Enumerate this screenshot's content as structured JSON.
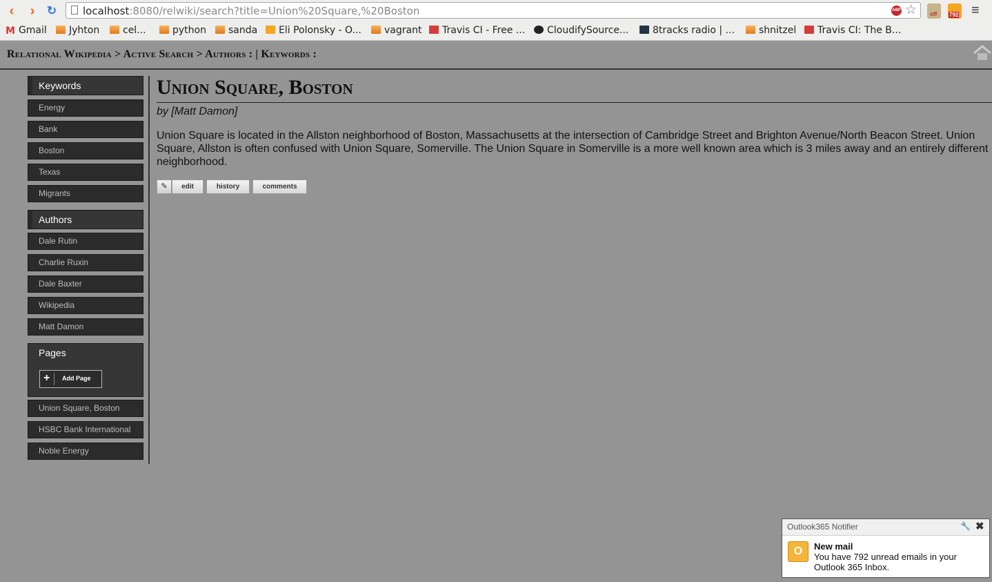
{
  "browser": {
    "url_host": "localhost",
    "url_rest": ":8080/relwiki/search?title=Union%20Square,%20Boston",
    "extension_badge": "792",
    "extension_badge_off": "off"
  },
  "bookmarks": [
    {
      "label": "Gmail",
      "icon": "gmail-icon"
    },
    {
      "label": "Jyhton",
      "icon": "folder-icon"
    },
    {
      "label": "cel...",
      "icon": "folder-icon"
    },
    {
      "label": "python",
      "icon": "folder-icon"
    },
    {
      "label": "sanda",
      "icon": "folder-icon"
    },
    {
      "label": "Eli Polonsky - O...",
      "icon": "office-icon"
    },
    {
      "label": "vagrant",
      "icon": "folder-icon"
    },
    {
      "label": "Travis CI - Free ...",
      "icon": "travis-icon"
    },
    {
      "label": "CloudifySource...",
      "icon": "github-icon"
    },
    {
      "label": "8tracks radio | ...",
      "icon": "8tracks-icon"
    },
    {
      "label": "shnitzel",
      "icon": "folder-icon"
    },
    {
      "label": "Travis CI: The B...",
      "icon": "travis-icon"
    }
  ],
  "breadcrumb": "Relational Wikipedia > Active Search > Authors : | Keywords :",
  "sidebar": {
    "keywords_title": "Keywords",
    "keywords": [
      "Energy",
      "Bank",
      "Boston",
      "Texas",
      "Migrants"
    ],
    "authors_title": "Authors",
    "authors": [
      "Dale Rutin",
      "Charlie Ruxin",
      "Dale Baxter",
      "Wikipedia",
      "Matt Damon"
    ],
    "pages_title": "Pages",
    "add_page_label": "Add Page",
    "pages": [
      "Union Square, Boston",
      "HSBC Bank International",
      "Noble Energy"
    ]
  },
  "article": {
    "title": "Union Square, Boston",
    "byline": "by [Matt Damon]",
    "body": "Union Square is located in the Allston neighborhood of Boston, Massachusetts at the intersection of Cambridge Street and Brighton Avenue/North Beacon Street. Union Square, Allston is often confused with Union Square, Somerville. The Union Square in Somerville is a more well known area which is 3 miles away and an entirely different neighborhood.",
    "edit_label": "edit",
    "history_label": "history",
    "comments_label": "comments"
  },
  "notifier": {
    "title": "Outlook365 Notifier",
    "heading": "New mail",
    "body": "You have 792 unread emails in your Outlook 365 Inbox."
  },
  "colors": {
    "page_bg": "#949494",
    "sidebar_item_bg": "#2b2b2b",
    "sidebar_head_bg": "#363636",
    "nav_accent": "#e86a1a"
  }
}
